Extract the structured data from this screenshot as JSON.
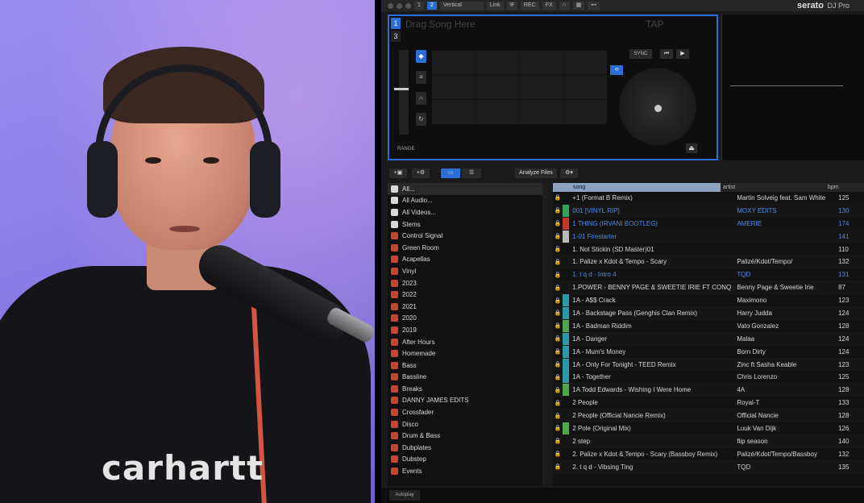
{
  "webcam": {
    "shirt_text": "carhartt"
  },
  "topbar": {
    "deck_count_1": "1",
    "deck_count_2": "2",
    "layout_select": "Vertical",
    "link": "Link",
    "rec": "REC",
    "fx": "FX",
    "brand": "serato",
    "product": "DJ Pro"
  },
  "deck": {
    "number_active": "1",
    "number_other": "3",
    "drag_placeholder": "Drag Song Here",
    "tap": "TAP",
    "sync": "SYNC",
    "range": "RANGE",
    "play": "▶",
    "cue": "⏮",
    "eject": "⏏",
    "loop": "⟲"
  },
  "library_bar": {
    "analyze_files": "Analyze Files"
  },
  "crates": [
    {
      "label": "All...",
      "kind": "sys"
    },
    {
      "label": "All Audio...",
      "kind": "sys"
    },
    {
      "label": "All Videos...",
      "kind": "sys"
    },
    {
      "label": "Stems",
      "kind": "sys"
    },
    {
      "label": "Control Signal",
      "kind": "crate"
    },
    {
      "label": "Green Room",
      "kind": "crate"
    },
    {
      "label": "Acapellas",
      "kind": "crate"
    },
    {
      "label": "Vinyl",
      "kind": "crate"
    },
    {
      "label": "2023",
      "kind": "crate"
    },
    {
      "label": "2022",
      "kind": "crate"
    },
    {
      "label": "2021",
      "kind": "crate"
    },
    {
      "label": "2020",
      "kind": "crate"
    },
    {
      "label": "2019",
      "kind": "crate"
    },
    {
      "label": "After Hours",
      "kind": "crate"
    },
    {
      "label": "Homemade",
      "kind": "crate"
    },
    {
      "label": "Bass",
      "kind": "crate"
    },
    {
      "label": "Bassline",
      "kind": "crate"
    },
    {
      "label": "Breaks",
      "kind": "crate"
    },
    {
      "label": "DANNY JAMES EDITS",
      "kind": "crate"
    },
    {
      "label": "Crossfader",
      "kind": "crate"
    },
    {
      "label": "Disco",
      "kind": "crate"
    },
    {
      "label": "Drum & Bass",
      "kind": "crate"
    },
    {
      "label": "Dubplates",
      "kind": "crate"
    },
    {
      "label": "Dubstep",
      "kind": "crate"
    },
    {
      "label": "Events",
      "kind": "crate"
    }
  ],
  "track_headers": {
    "song": "song",
    "artist": "artist",
    "bpm": "bpm"
  },
  "tracks": [
    {
      "song": "+1 (Format B Remix)",
      "artist": "Martin Solveig feat. Sam White",
      "bpm": "125",
      "color": "",
      "style": ""
    },
    {
      "song": "001 [VINYL RIP]",
      "artist": "MOXY EDITS",
      "bpm": "130",
      "color": "#33a35a",
      "style": "blue"
    },
    {
      "song": "1 THING (IRVANI BOOTLEG)",
      "artist": "AMERIE",
      "bpm": "174",
      "color": "#c0392b",
      "style": "blue"
    },
    {
      "song": "1-01 Firestarter",
      "artist": "",
      "bpm": "141",
      "color": "#b8b8b8",
      "style": "blue"
    },
    {
      "song": "1. Not Stickin (SD Master)01",
      "artist": "",
      "bpm": "110",
      "color": "",
      "style": ""
    },
    {
      "song": "1. Palize  x Kdot & Tempo - Scary",
      "artist": "Palizé/Kdot/Tempo/",
      "bpm": "132",
      "color": "",
      "style": ""
    },
    {
      "song": "1. t q d - Intro 4",
      "artist": "TQD",
      "bpm": "131",
      "color": "",
      "style": "blue"
    },
    {
      "song": "1.POWER - BENNY PAGE & SWEETIE IRIE FT CONQ",
      "artist": "Benny Page & Sweetie Irie",
      "bpm": "87",
      "color": "",
      "style": ""
    },
    {
      "song": "1A - A$$ Crack",
      "artist": "Maximono",
      "bpm": "123",
      "color": "#2a9aa8",
      "style": ""
    },
    {
      "song": "1A - Backstage Pass (Genghis Clan Remix)",
      "artist": "Harry Judda",
      "bpm": "124",
      "color": "#2a9aa8",
      "style": ""
    },
    {
      "song": "1A - Badman Riddim",
      "artist": "Vato Gonzalez",
      "bpm": "128",
      "color": "#4aa84a",
      "style": ""
    },
    {
      "song": "1A - Danger",
      "artist": "Malaa",
      "bpm": "124",
      "color": "#2a9aa8",
      "style": ""
    },
    {
      "song": "1A - Mum's Money",
      "artist": "Born Dirty",
      "bpm": "124",
      "color": "#2a9aa8",
      "style": ""
    },
    {
      "song": "1A - Only For Tonight - TEED Remix",
      "artist": "Zinc ft Sasha Keable",
      "bpm": "123",
      "color": "#2a9aa8",
      "style": ""
    },
    {
      "song": "1A - Together",
      "artist": "Chris Lorenzo",
      "bpm": "125",
      "color": "#2a9aa8",
      "style": ""
    },
    {
      "song": "1A Todd Edwards - Wishing I Were Home",
      "artist": "4A",
      "bpm": "128",
      "color": "#4aa84a",
      "style": ""
    },
    {
      "song": "2 People",
      "artist": "Royal-T",
      "bpm": "133",
      "color": "",
      "style": ""
    },
    {
      "song": "2 People (Official Nancie Remix)",
      "artist": "Official Nancie",
      "bpm": "128",
      "color": "",
      "style": ""
    },
    {
      "song": "2 Pole (Original Mix)",
      "artist": "Luuk Van Dijk",
      "bpm": "126",
      "color": "#4aa84a",
      "style": ""
    },
    {
      "song": "2 step",
      "artist": "flip season",
      "bpm": "140",
      "color": "",
      "style": ""
    },
    {
      "song": "2. Palize x Kdot & Tempo - Scary (Bassboy Remix)",
      "artist": "Palizé/Kdot/Tempo/Bassboy",
      "bpm": "132",
      "color": "",
      "style": ""
    },
    {
      "song": "2. t q d - Vibsing Ting",
      "artist": "TQD",
      "bpm": "135",
      "color": "",
      "style": ""
    }
  ],
  "bottom": {
    "autoplay": "Autoplay"
  }
}
